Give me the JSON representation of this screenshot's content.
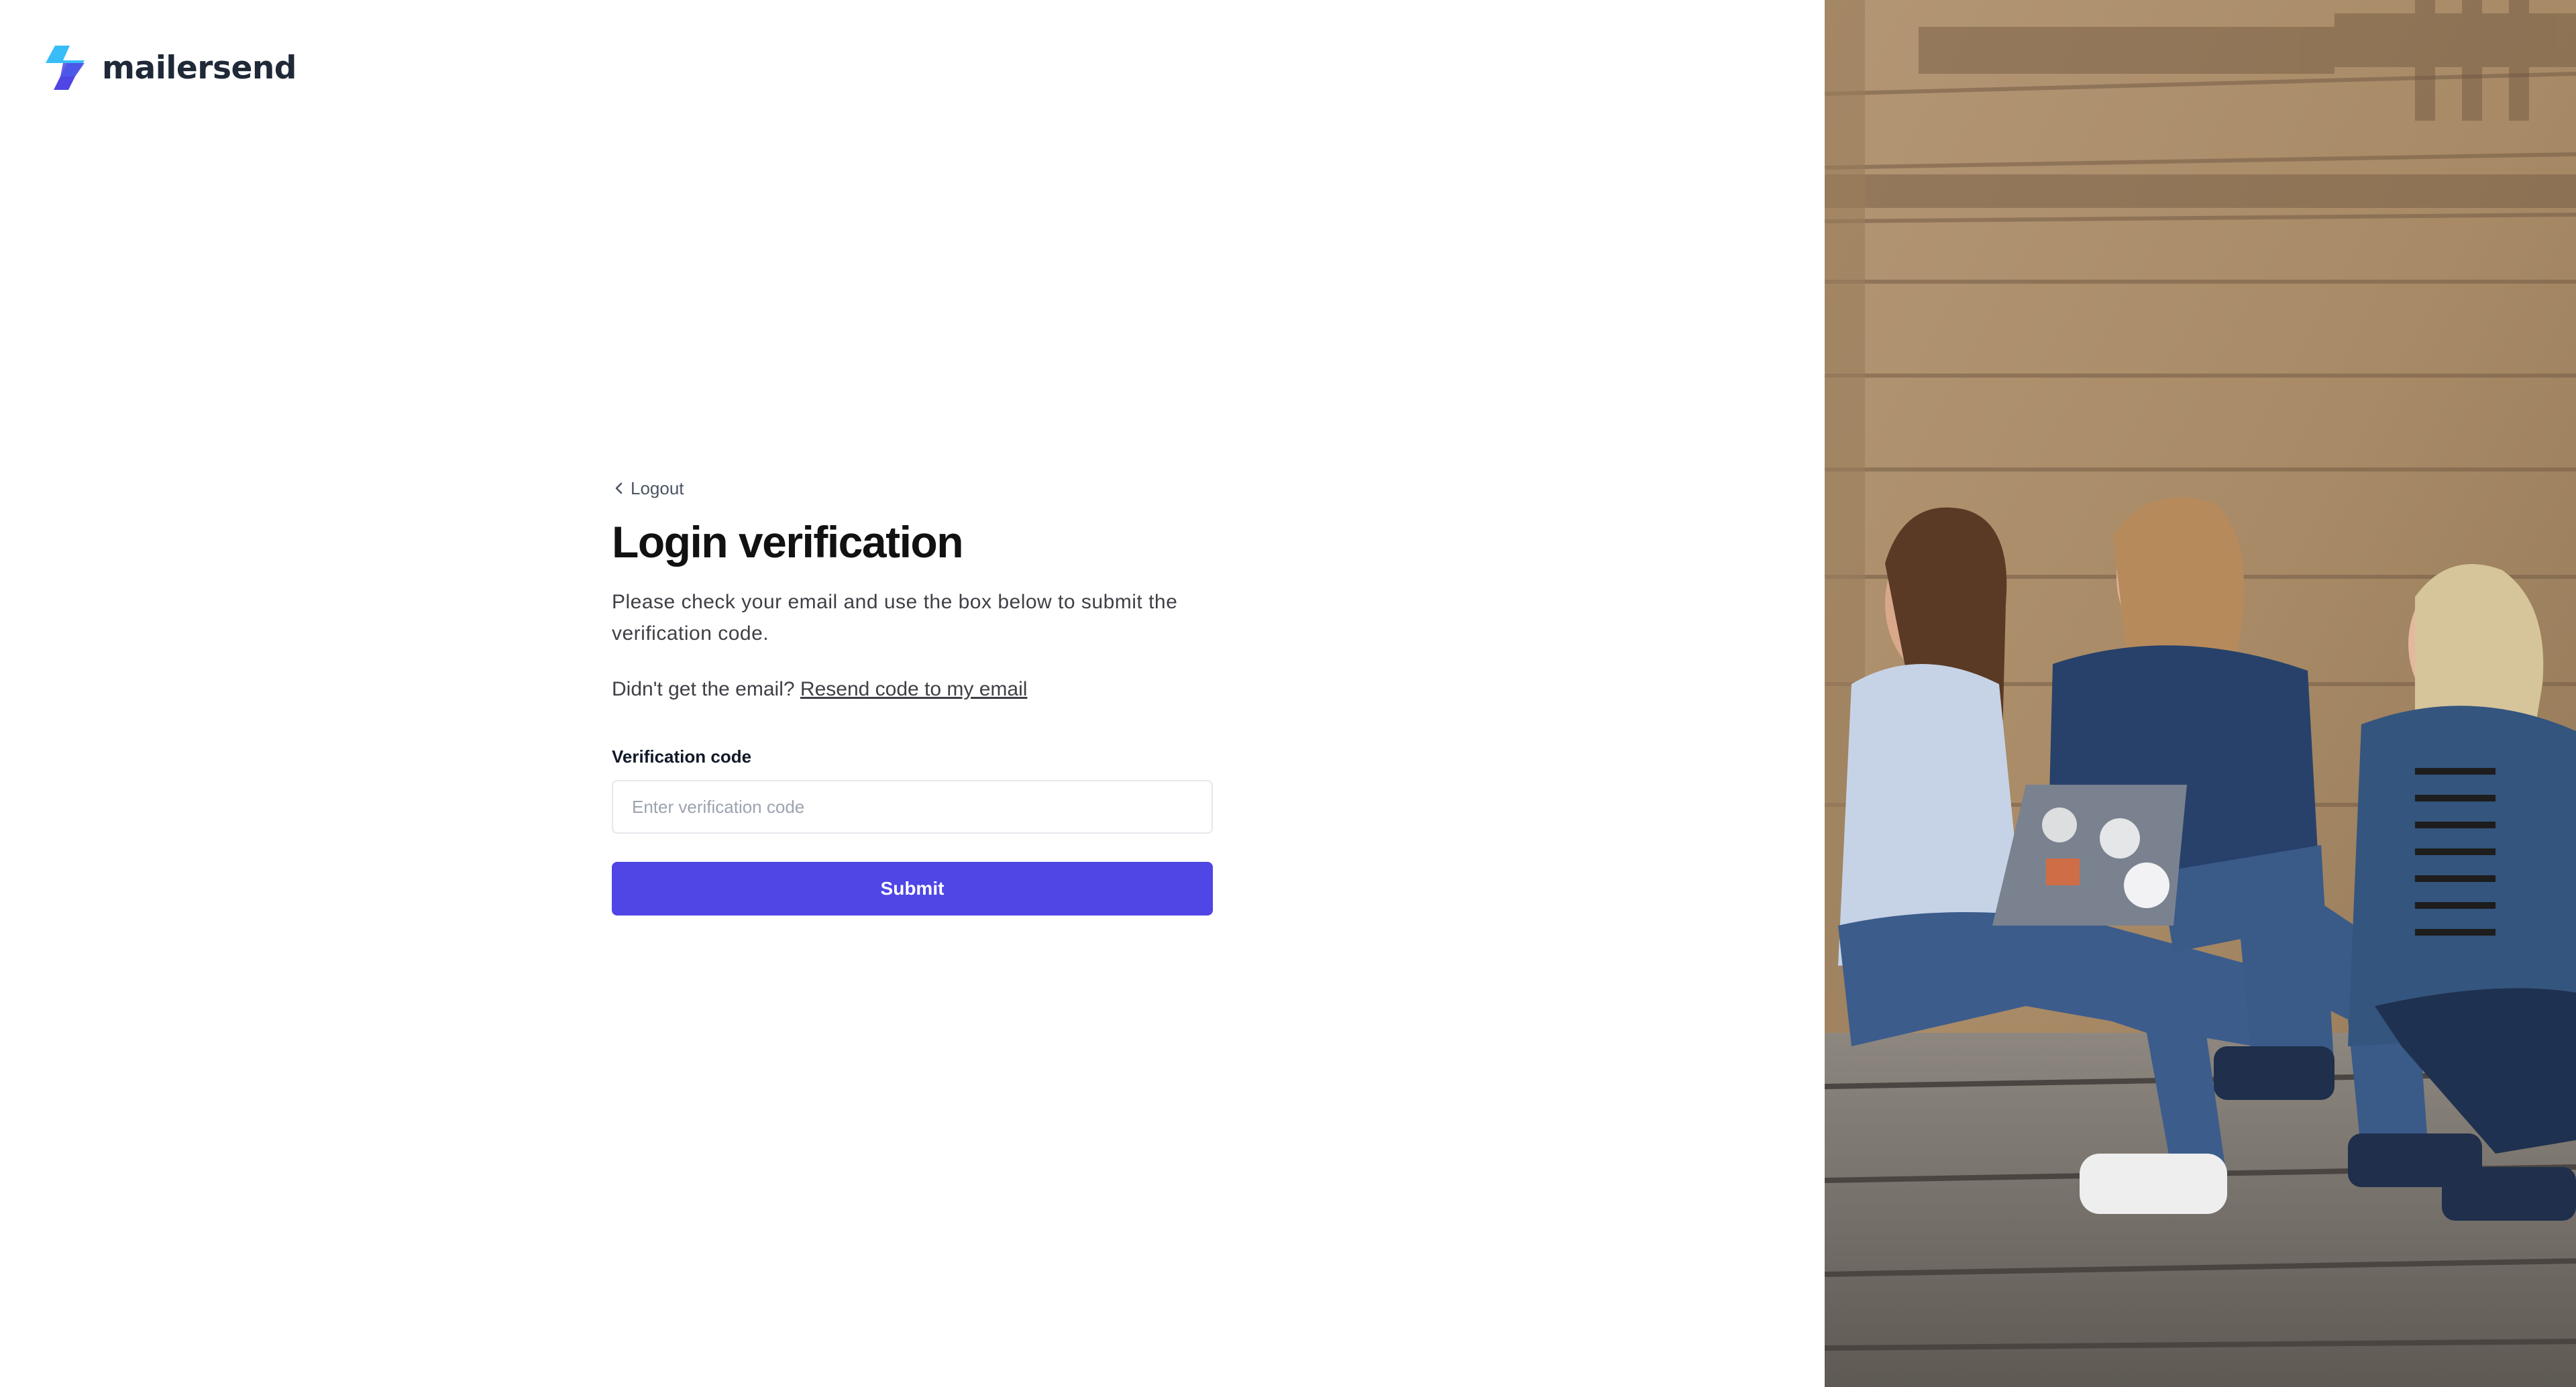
{
  "brand": {
    "name": "mailersend",
    "accent": "#4f46e5",
    "logo_colors": [
      "#38bdf8",
      "#4f46e5"
    ]
  },
  "nav": {
    "back_label": "Logout",
    "back_icon": "chevron-left-icon"
  },
  "main": {
    "title": "Login verification",
    "description": "Please check your email and use the box below to submit the verification code.",
    "resend_prompt": "Didn't get the email?",
    "resend_link": "Resend code to my email"
  },
  "form": {
    "code_label": "Verification code",
    "code_value": "",
    "code_placeholder": "Enter verification code",
    "submit_label": "Submit"
  },
  "hero": {
    "image": "photo-three-women-sitting-on-stone-steps-with-laptop"
  }
}
